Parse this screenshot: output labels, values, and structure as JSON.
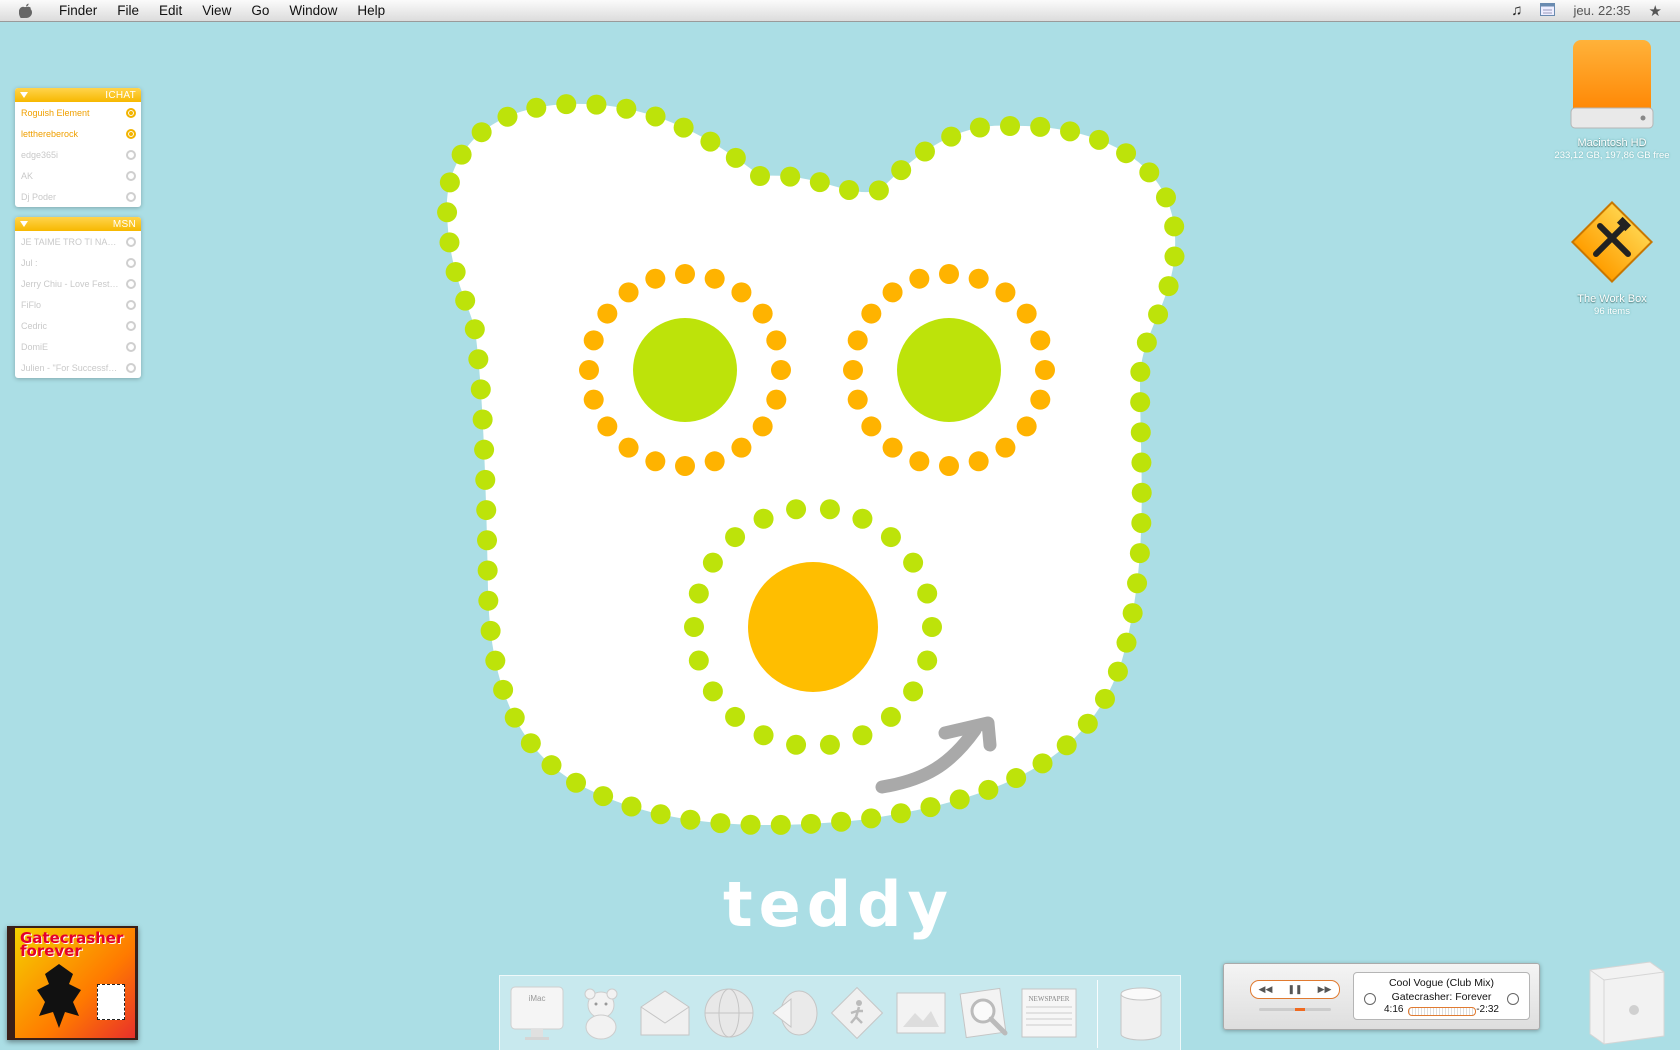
{
  "menubar": {
    "items": [
      "Finder",
      "File",
      "Edit",
      "View",
      "Go",
      "Window",
      "Help"
    ],
    "clock": "jeu. 22:35"
  },
  "ichat": {
    "title": "ICHAT",
    "contacts": [
      {
        "name": "Roguish Element",
        "online": true
      },
      {
        "name": "letthereberock",
        "online": true
      },
      {
        "name": "edge365i",
        "online": false
      },
      {
        "name": "AK",
        "online": false
      },
      {
        "name": "Dj Poder",
        "online": false
      }
    ]
  },
  "msn": {
    "title": "MSN",
    "contacts": [
      {
        "name": "JE TAIME TRO TI NAM...",
        "online": false
      },
      {
        "name": "Jul :",
        "online": false
      },
      {
        "name": "Jerry Chiu - Love Fest o...",
        "online": false
      },
      {
        "name": "FiFlo",
        "online": false
      },
      {
        "name": "Cedric",
        "online": false
      },
      {
        "name": "DomiE",
        "online": false
      },
      {
        "name": "Julien - \"For Successful l...",
        "online": false
      }
    ]
  },
  "wallpaper": {
    "label": "teddy",
    "colors": {
      "background": "#abdee5",
      "green": "#bde30a",
      "orange": "#ffb300",
      "face": "#ffffff",
      "arrow": "#a9a9a9"
    }
  },
  "desktop": {
    "hd": {
      "name": "Macintosh HD",
      "info": "233,12 GB, 197,86 GB free"
    },
    "workbox": {
      "name": "The Work Box",
      "info": "96 items"
    }
  },
  "album": {
    "title_line1": "Gatecrasher",
    "title_line2": "forever"
  },
  "dock": {
    "items": [
      "iMac",
      "Teddy",
      "Mail",
      "Internet",
      "Music",
      "Activity",
      "Photos",
      "Search",
      "Newspaper",
      "Disks"
    ],
    "imac_label": "iMac",
    "newspaper_label": "NEWSPAPER"
  },
  "itunes": {
    "track": "Cool Vogue (Club Mix)",
    "album": "Gatecrasher: Forever",
    "elapsed": "4:16",
    "remaining": "-2:32"
  }
}
